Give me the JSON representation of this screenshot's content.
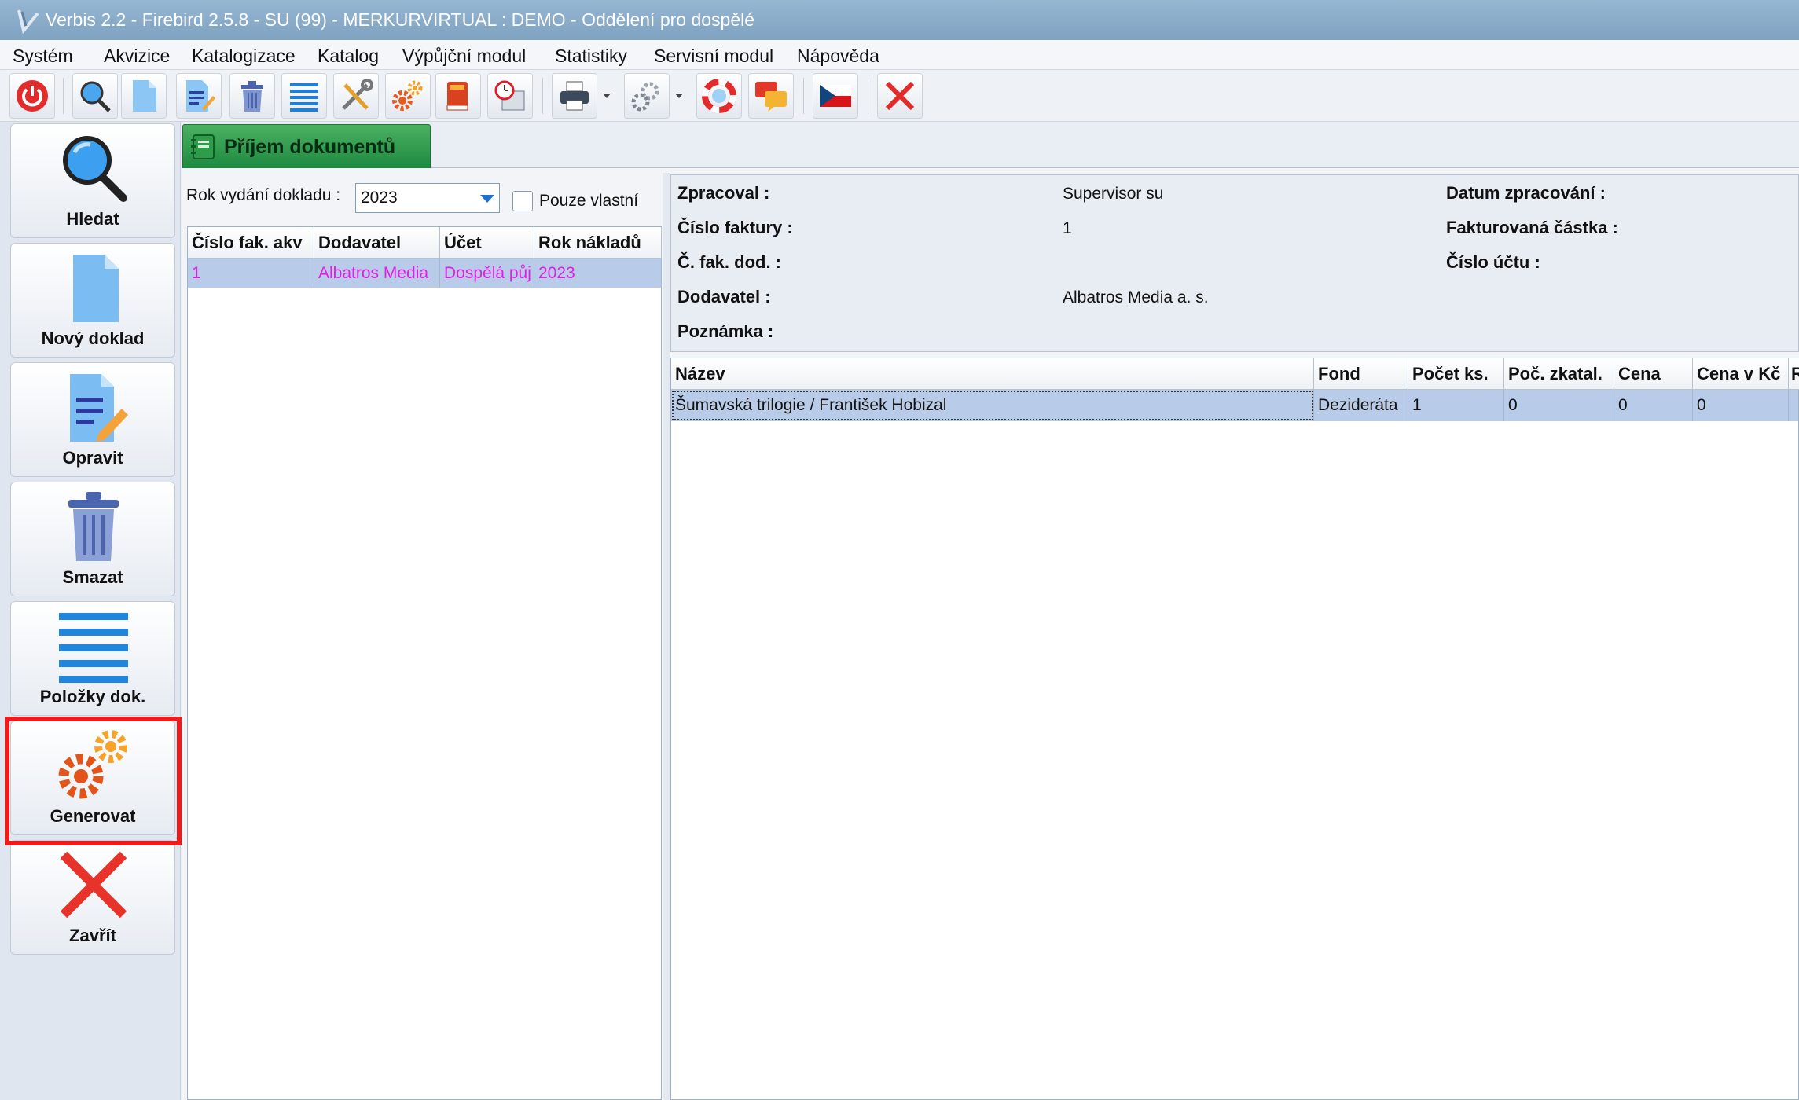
{
  "window": {
    "title": "Verbis 2.2 - Firebird 2.5.8 - SU (99) - MERKURVIRTUAL : DEMO - Oddělení pro dospělé"
  },
  "menu": [
    "Systém",
    "Akvizice",
    "Katalogizace",
    "Katalog",
    "Výpůjční modul",
    "Statistiky",
    "Servisní modul",
    "Nápověda"
  ],
  "toolbar": {
    "icons": [
      "power-icon",
      "search-icon",
      "new-document-icon",
      "edit-document-icon",
      "trash-icon",
      "list-icon",
      "tools-icon",
      "gears-icon",
      "book-icon",
      "calendar-clock-icon",
      "printer-icon",
      "settings-gear-icon",
      "lifebuoy-icon",
      "chat-icon",
      "czech-flag-icon",
      "close-icon"
    ]
  },
  "sidebar": {
    "buttons": [
      {
        "label": "Hledat",
        "icon": "search-icon"
      },
      {
        "label": "Nový doklad",
        "icon": "new-document-icon"
      },
      {
        "label": "Opravit",
        "icon": "edit-document-icon"
      },
      {
        "label": "Smazat",
        "icon": "trash-icon"
      },
      {
        "label": "Položky dok.",
        "icon": "list-icon"
      },
      {
        "label": "Generovat",
        "icon": "gears-icon"
      },
      {
        "label": "Zavřít",
        "icon": "close-icon"
      }
    ]
  },
  "tab": {
    "label": "Příjem dokumentů"
  },
  "filter": {
    "year_label": "Rok vydání dokladu :",
    "year_value": "2023",
    "own_only_label": "Pouze vlastní",
    "own_only_checked": false
  },
  "left_table": {
    "headers": [
      "Číslo fak. akv",
      "Dodavatel",
      "Účet",
      "Rok nákladů"
    ],
    "rows": [
      [
        "1",
        "Albatros Media",
        "Dospělá půj",
        "2023"
      ]
    ]
  },
  "detail": {
    "processed_by_label": "Zpracoval :",
    "processed_by_value": "Supervisor su",
    "processed_date_label": "Datum zpracování :",
    "invoice_number_label": "Číslo faktury :",
    "invoice_number_value": "1",
    "invoiced_amount_label": "Fakturovaná částka :",
    "supplier_invoice_label": "Č. fak. dod. :",
    "account_number_label": "Číslo účtu :",
    "supplier_label": "Dodavatel :",
    "supplier_value": "Albatros Media a. s.",
    "note_label": "Poznámka :"
  },
  "right_table": {
    "headers": [
      "Název",
      "Fond",
      "Počet ks.",
      "Poč. zkatal.",
      "Cena",
      "Cena v Kč",
      "R"
    ],
    "rows": [
      [
        "Šumavská trilogie / František Hobizal",
        "Dezideráta",
        "1",
        "0",
        "0",
        "0",
        ""
      ]
    ]
  },
  "colors": {
    "highlight": "#ee1b1b",
    "selected_row": "#b8cbe8",
    "link_text": "#e21ee6",
    "tab": "#2e9a4e"
  }
}
